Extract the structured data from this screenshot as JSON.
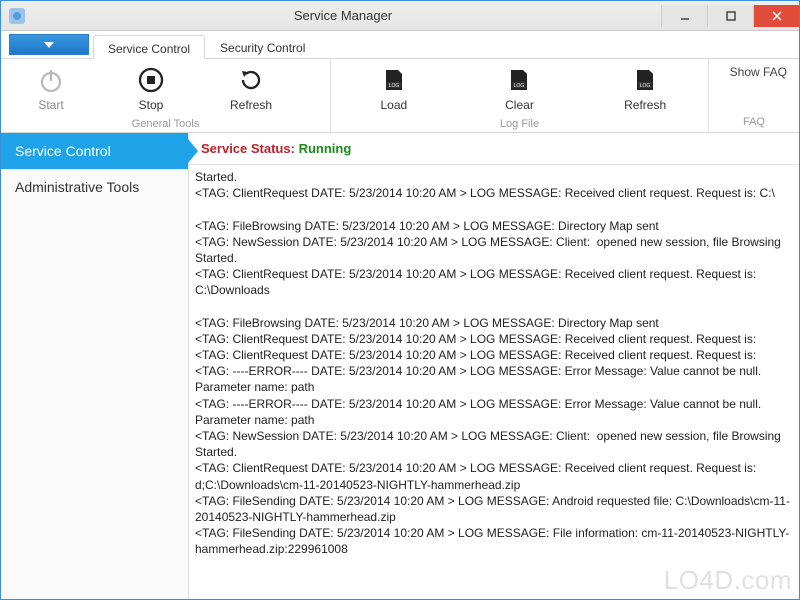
{
  "window": {
    "title": "Service Manager"
  },
  "tabs": {
    "items": [
      {
        "label": "Service Control",
        "active": true
      },
      {
        "label": "Security Control",
        "active": false
      }
    ]
  },
  "ribbon": {
    "groups": [
      {
        "label": "General Tools",
        "buttons": [
          {
            "id": "start",
            "label": "Start",
            "icon": "power-icon",
            "enabled": false
          },
          {
            "id": "stop",
            "label": "Stop",
            "icon": "stop-icon",
            "enabled": true
          },
          {
            "id": "refresh1",
            "label": "Refresh",
            "icon": "refresh-icon",
            "enabled": true
          }
        ]
      },
      {
        "label": "Log File",
        "buttons": [
          {
            "id": "load",
            "label": "Load",
            "icon": "log-icon",
            "enabled": true
          },
          {
            "id": "clear",
            "label": "Clear",
            "icon": "log-icon",
            "enabled": true
          },
          {
            "id": "refresh2",
            "label": "Refresh",
            "icon": "log-icon",
            "enabled": true
          }
        ]
      }
    ],
    "faq": {
      "link_label": "Show FAQ",
      "group_label": "FAQ"
    }
  },
  "sidebar": {
    "items": [
      {
        "label": "Service Control",
        "active": true
      },
      {
        "label": "Administrative Tools",
        "active": false
      }
    ]
  },
  "status": {
    "label": "Service Status:",
    "value": "Running"
  },
  "log_lines": [
    "Started.",
    "<TAG: ClientRequest DATE: 5/23/2014 10:20 AM > LOG MESSAGE: Received client request. Request is: C:\\",
    "",
    "<TAG: FileBrowsing DATE: 5/23/2014 10:20 AM > LOG MESSAGE: Directory Map sent",
    "<TAG: NewSession DATE: 5/23/2014 10:20 AM > LOG MESSAGE: Client:  opened new session, file Browsing Started.",
    "<TAG: ClientRequest DATE: 5/23/2014 10:20 AM > LOG MESSAGE: Received client request. Request is: C:\\Downloads",
    "",
    "<TAG: FileBrowsing DATE: 5/23/2014 10:20 AM > LOG MESSAGE: Directory Map sent",
    "<TAG: ClientRequest DATE: 5/23/2014 10:20 AM > LOG MESSAGE: Received client request. Request is:",
    "<TAG: ClientRequest DATE: 5/23/2014 10:20 AM > LOG MESSAGE: Received client request. Request is:",
    "<TAG: ----ERROR---- DATE: 5/23/2014 10:20 AM > LOG MESSAGE: Error Message: Value cannot be null.",
    "Parameter name: path",
    "<TAG: ----ERROR---- DATE: 5/23/2014 10:20 AM > LOG MESSAGE: Error Message: Value cannot be null.",
    "Parameter name: path",
    "<TAG: NewSession DATE: 5/23/2014 10:20 AM > LOG MESSAGE: Client:  opened new session, file Browsing Started.",
    "<TAG: ClientRequest DATE: 5/23/2014 10:20 AM > LOG MESSAGE: Received client request. Request is: d;C:\\Downloads\\cm-11-20140523-NIGHTLY-hammerhead.zip",
    "<TAG: FileSending DATE: 5/23/2014 10:20 AM > LOG MESSAGE: Android requested file: C:\\Downloads\\cm-11-20140523-NIGHTLY-hammerhead.zip",
    "<TAG: FileSending DATE: 5/23/2014 10:20 AM > LOG MESSAGE: File information: cm-11-20140523-NIGHTLY-hammerhead.zip:229961008"
  ],
  "watermark": "LO4D.com"
}
